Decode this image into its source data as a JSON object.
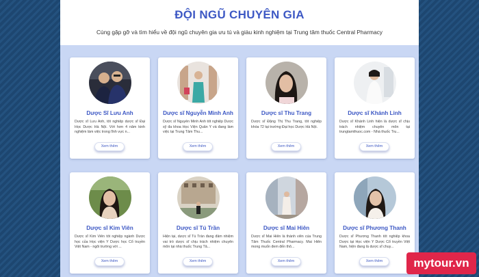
{
  "header": {
    "title": "ĐỘI NGŨ CHUYÊN GIA",
    "subtitle": "Cùng gặp gỡ và tìm hiểu về đội ngũ chuyên gia ưu tú và giàu kinh nghiệm tại Trung tâm thuốc Central Pharmacy"
  },
  "button_label": "Xem thêm",
  "experts": [
    {
      "name": "Dược Sĩ Lưu Anh",
      "desc": "Dược sĩ Lưu Anh, tốt nghiệp dược sĩ Đại Học Dược Hà Nội. Với hơn 4 năm kinh nghiệm làm việc trong lĩnh vực n..."
    },
    {
      "name": "Dược sĩ Nguyễn Minh Anh",
      "desc": "Dược sĩ Nguyễn Minh Anh tốt nghiệp Dược sỹ đa khoa Học Viện Quân Y và đang làm việc tại Trung Tâm Thu..."
    },
    {
      "name": "Dược sĩ Thu Trang",
      "desc": "Dược sĩ Đặng Thị Thu Trang, tốt nghiệp khóa 72 tại trường Đại học Dược Hà Nội."
    },
    {
      "name": "Dược sĩ Khánh Linh",
      "desc": "Dược sĩ Khánh Linh hiện là dược sĩ chịu trách nhiệm chuyên môn tại trungtamthuoc.com - Nhà thuốc Tru..."
    },
    {
      "name": "Dược sĩ Kim Viên",
      "desc": "Dược sĩ Kim Viên tốt nghiệp ngành Dược học của Học viện Y Dược học Cổ truyền Việt Nam - ngôi trường với ..."
    },
    {
      "name": "Dược sĩ Tú Trần",
      "desc": "Hiện tại, dược sĩ Tú Trần đang đảm nhiệm vai trò dược sĩ chịu trách nhiệm chuyên môn tại nhà thuốc Trung Tâ..."
    },
    {
      "name": "Dược sĩ Mai Hiên",
      "desc": "Dược sĩ Mai Hiên là thành viên của Trung Tâm Thuốc Central Pharmacy. Mai Hiên mong muốn đem đến thô..."
    },
    {
      "name": "Dược sĩ Phương Thanh",
      "desc": "Dược sĩ Phương Thanh tốt nghiệp khoa Dược tại Học viện Y Dược Cổ truyền Việt Nam, hiện đang là dược sĩ chuy..."
    }
  ],
  "brand": {
    "logo": "mytour.vn"
  }
}
